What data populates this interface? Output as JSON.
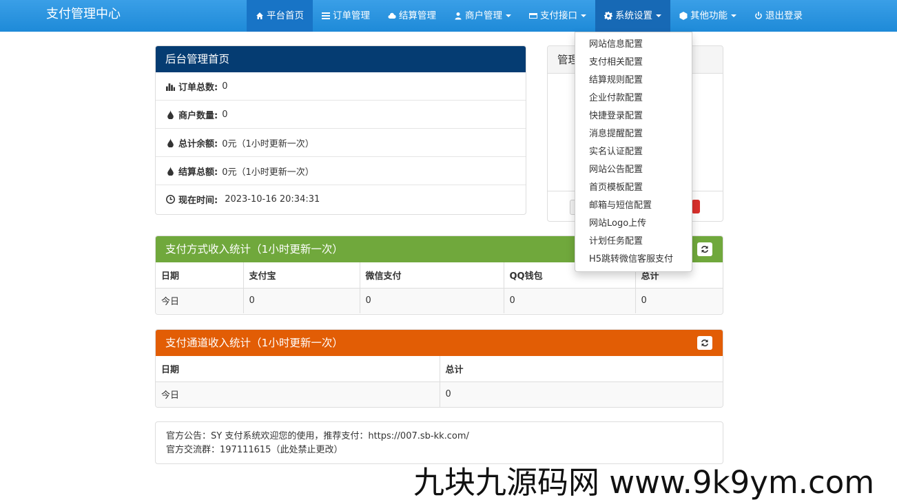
{
  "navbar": {
    "brand": "支付管理中心",
    "items": [
      {
        "label": "平台首页",
        "icon": "home-icon"
      },
      {
        "label": "订单管理",
        "icon": "list-icon"
      },
      {
        "label": "结算管理",
        "icon": "cloud-icon"
      },
      {
        "label": "商户管理",
        "icon": "user-icon"
      },
      {
        "label": "支付接口",
        "icon": "credit-card-icon"
      },
      {
        "label": "系统设置",
        "icon": "gear-icon"
      },
      {
        "label": "其他功能",
        "icon": "cube-icon"
      },
      {
        "label": "退出登录",
        "icon": "power-icon"
      }
    ]
  },
  "dashboard": {
    "title": "后台管理首页",
    "stats": [
      {
        "label": "订单总数:",
        "value": "0",
        "icon": "bar-chart-icon"
      },
      {
        "label": "商户数量:",
        "value": "0",
        "icon": "tint-icon"
      },
      {
        "label": "总计余额:",
        "value": "0元（1小时更新一次）",
        "icon": "tint-icon"
      },
      {
        "label": "结算总额:",
        "value": "0元（1小时更新一次）",
        "icon": "tint-icon"
      },
      {
        "label": "现在时间:",
        "value": "2023-10-16 20:34:31",
        "icon": "clock-icon"
      }
    ]
  },
  "admin_panel": {
    "title": "管理"
  },
  "pay_method_stats": {
    "title": "支付方式收入统计（1小时更新一次）",
    "columns": [
      "日期",
      "支付宝",
      "微信支付",
      "QQ钱包",
      "总计"
    ],
    "rows": [
      [
        "今日",
        "0",
        "0",
        "0",
        "0"
      ]
    ]
  },
  "channel_stats": {
    "title": "支付通道收入统计（1小时更新一次）",
    "columns": [
      "日期",
      "总计"
    ],
    "rows": [
      [
        "今日",
        "0"
      ]
    ]
  },
  "notice": {
    "line1": "官方公告：SY 支付系统欢迎您的使用，推荐支付：https://007.sb-kk.com/",
    "line2": "官方交流群：197111615（此处禁止更改）"
  },
  "settings_menu": [
    "网站信息配置",
    "支付相关配置",
    "结算规则配置",
    "企业付款配置",
    "快捷登录配置",
    "消息提醒配置",
    "实名认证配置",
    "网站公告配置",
    "首页模板配置",
    "邮箱与短信配置",
    "网站Logo上传",
    "计划任务配置",
    "H5跳转微信客服支付"
  ],
  "watermark": "九块九源码网 www.9k9ym.com",
  "colors": {
    "navbar": "#2196e0",
    "dashboard_header": "#053c72",
    "green_header": "#70a83c",
    "orange_header": "#e25d05"
  }
}
